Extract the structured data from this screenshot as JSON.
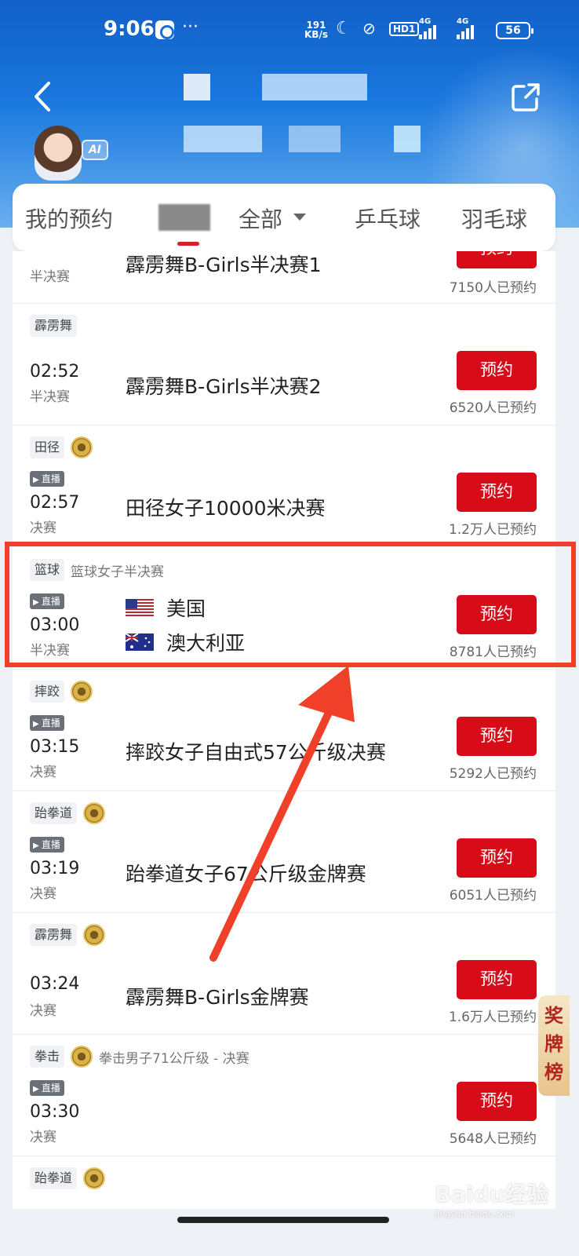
{
  "status_bar": {
    "time": "9:06",
    "dots": "···",
    "net_speed_value": "191",
    "net_speed_unit": "KB/s",
    "hd_label": "HD1",
    "sig1_label": "4G",
    "sig2_label": "4G",
    "battery": "56"
  },
  "header": {
    "back_icon": "back-chevron-icon",
    "share_icon": "share-icon",
    "ai_badge": "AI"
  },
  "tabs": {
    "mine": "我的预约",
    "all": "全部",
    "pingpong": "乒乓球",
    "badminton": "羽毛球"
  },
  "events": [
    {
      "category": "",
      "time": "",
      "stage": "半决赛",
      "title": "霹雳舞B-Girls半决赛1",
      "button": "预约",
      "count": "7150人已预约"
    },
    {
      "category": "霹雳舞",
      "medal": false,
      "live": false,
      "time": "02:52",
      "stage": "半决赛",
      "title": "霹雳舞B-Girls半决赛2",
      "button": "预约",
      "count": "6520人已预约"
    },
    {
      "category": "田径",
      "medal": true,
      "live": true,
      "live_label": "直播",
      "time": "02:57",
      "stage": "决赛",
      "title": "田径女子10000米决赛",
      "button": "预约",
      "count": "1.2万人已预约"
    },
    {
      "category": "篮球",
      "subtitle": "篮球女子半决赛",
      "medal": false,
      "live": true,
      "live_label": "直播",
      "time": "03:00",
      "stage": "半决赛",
      "teams": [
        "美国",
        "澳大利亚"
      ],
      "button": "预约",
      "count": "8781人已预约"
    },
    {
      "category": "摔跤",
      "medal": true,
      "live": true,
      "live_label": "直播",
      "time": "03:15",
      "stage": "决赛",
      "title": "摔跤女子自由式57公斤级决赛",
      "button": "预约",
      "count": "5292人已预约"
    },
    {
      "category": "跆拳道",
      "medal": true,
      "live": true,
      "live_label": "直播",
      "time": "03:19",
      "stage": "决赛",
      "title": "跆拳道女子67公斤级金牌赛",
      "button": "预约",
      "count": "6051人已预约"
    },
    {
      "category": "霹雳舞",
      "medal": true,
      "live": false,
      "time": "03:24",
      "stage": "决赛",
      "title": "霹雳舞B-Girls金牌赛",
      "button": "预约",
      "count": "1.6万人已预约"
    },
    {
      "category": "拳击",
      "subtitle": "拳击男子71公斤级 - 决赛",
      "medal": true,
      "live": true,
      "live_label": "直播",
      "time": "03:30",
      "stage": "决赛",
      "button": "预约",
      "count": "5648人已预约"
    },
    {
      "category": "跆拳道",
      "medal": true
    }
  ],
  "side_widget": {
    "line1": "奖",
    "line2": "牌",
    "line3": "榜"
  },
  "watermark": {
    "brand": "Baidu经验",
    "url": "jingyan.baidu.com"
  },
  "colors": {
    "accent_red": "#d70c18",
    "highlight": "#f1402a",
    "header_blue": "#1a78de"
  }
}
